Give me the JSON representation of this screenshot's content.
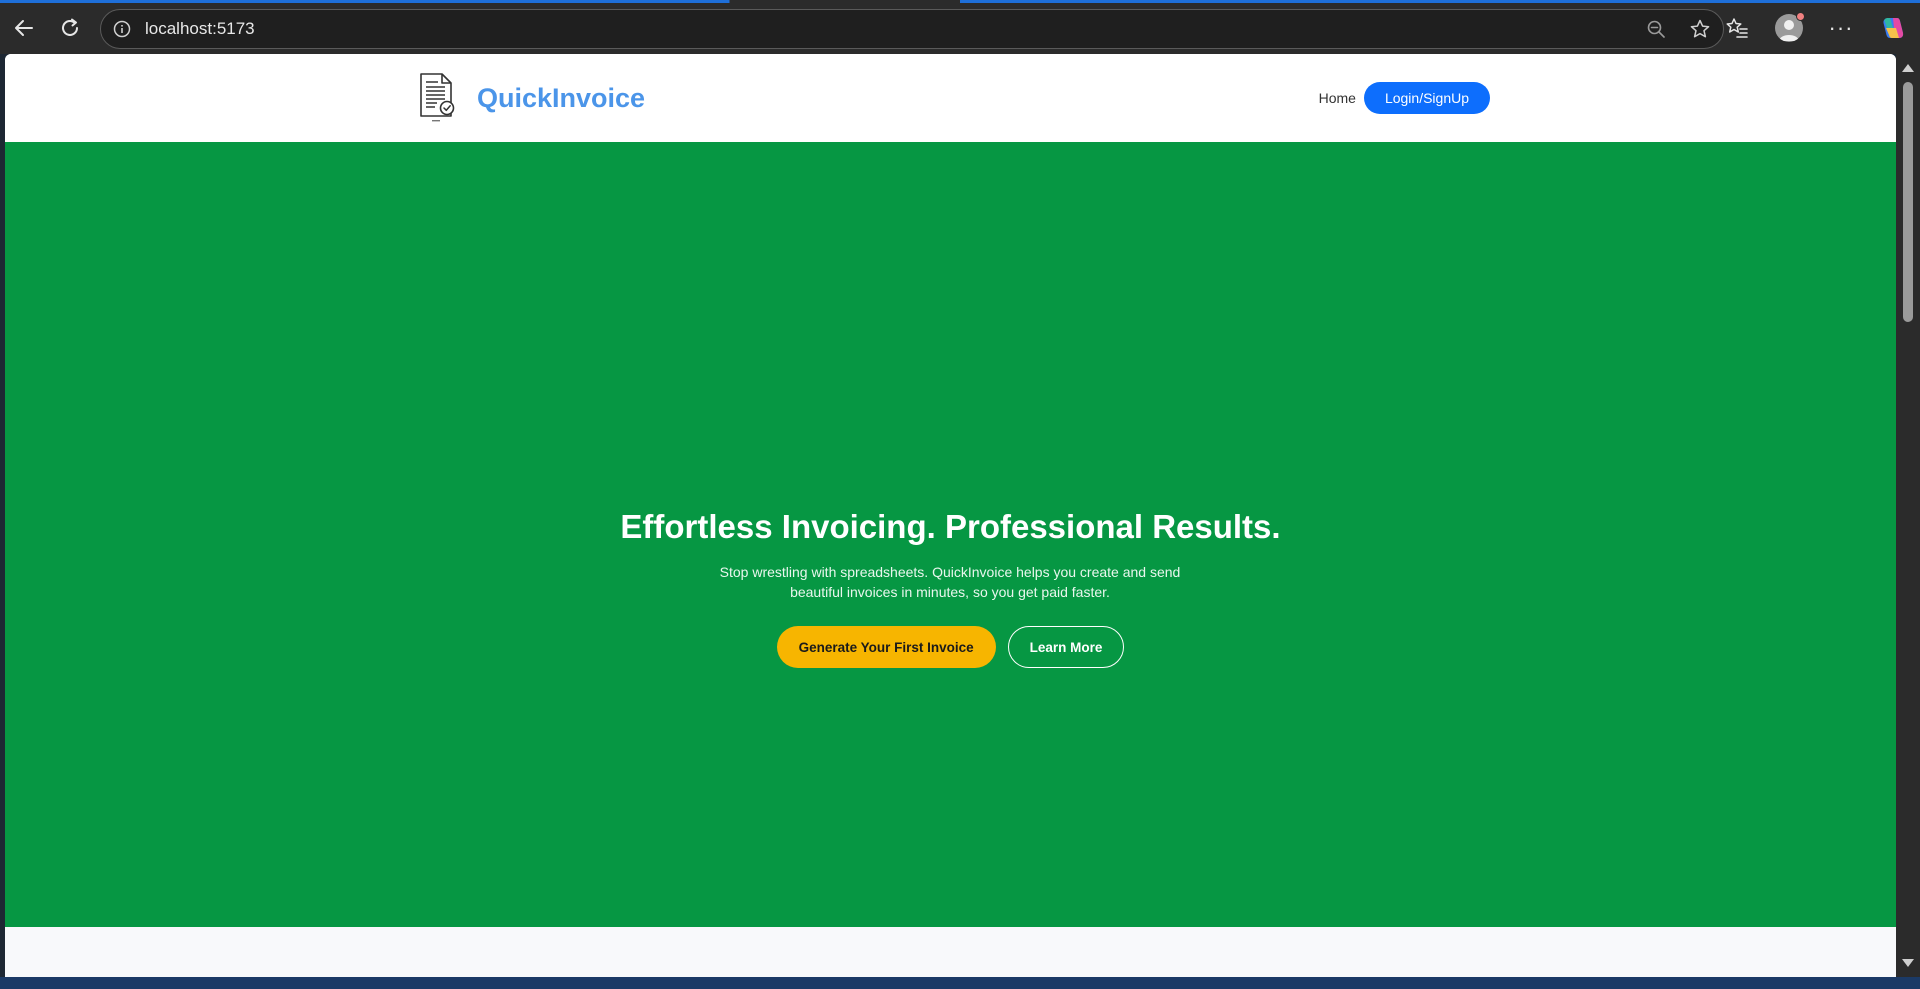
{
  "browser": {
    "url": "localhost:5173"
  },
  "site": {
    "brand_name": "QuickInvoice",
    "nav": {
      "home_label": "Home",
      "login_label": "Login/SignUp"
    }
  },
  "hero": {
    "title": "Effortless Invoicing. Professional Results.",
    "subtitle": "Stop wrestling with spreadsheets. QuickInvoice helps you create and send beautiful invoices in minutes, so you get paid faster.",
    "primary_cta": "Generate Your First Invoice",
    "secondary_cta": "Learn More"
  },
  "colors": {
    "brand": "#4b95e9",
    "hero_bg": "#069743",
    "login_button": "#0d6efd",
    "primary_cta": "#f7b500"
  },
  "icons": {
    "back": "arrow-left-icon",
    "reload": "reload-icon",
    "site_info": "info-icon",
    "zoom": "zoom-out-icon",
    "favorite": "star-icon",
    "favorites_list": "favorites-icon",
    "profile": "avatar",
    "menu": "more-icon",
    "copilot": "copilot-icon",
    "logo": "invoice-document-icon"
  }
}
